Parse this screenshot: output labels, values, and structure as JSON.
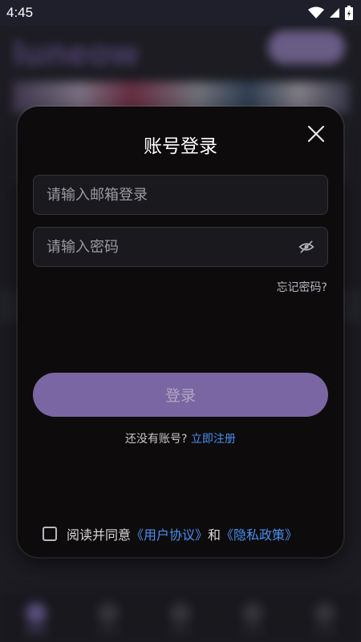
{
  "status_bar": {
    "time": "4:45"
  },
  "background": {
    "logo_text": "luneow"
  },
  "dialog": {
    "title": "账号登录",
    "email_placeholder": "请输入邮箱登录",
    "password_placeholder": "请输入密码",
    "forgot_label": "忘记密码?",
    "login_label": "登录",
    "no_account_text": "还没有账号? ",
    "register_link": "立即注册",
    "agree_prefix": "阅读并同意",
    "user_agreement": "《用户协议》",
    "and_text": "和",
    "privacy_policy": "《隐私政策》"
  },
  "colors": {
    "accent": "#7a66a3",
    "link": "#4a8ff0",
    "dialog_bg": "#0d0b0b"
  },
  "icons": [
    "wifi-icon",
    "signal-icon",
    "battery-icon",
    "close-icon",
    "eye-off-icon",
    "checkbox-icon"
  ]
}
